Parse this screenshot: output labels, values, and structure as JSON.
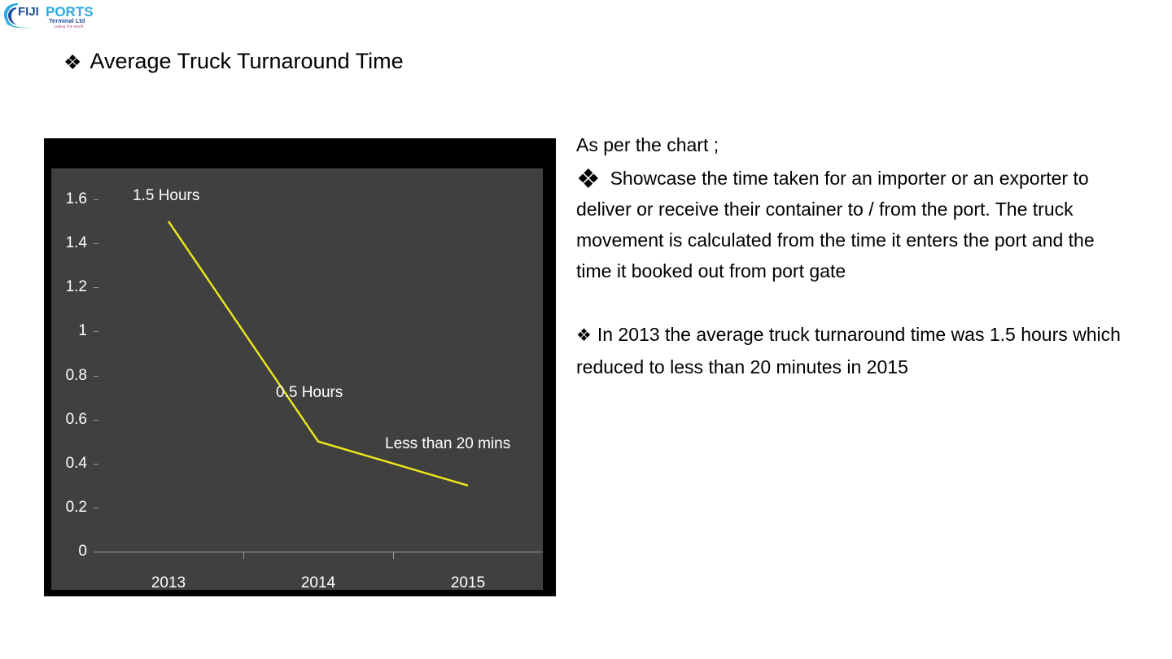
{
  "logo": {
    "brand_primary": "FIJI",
    "brand_secondary": "PORTS",
    "sub_line": "Terminal Ltd",
    "tagline": "Linking The World",
    "color_blue": "#1f4e9c",
    "color_cyan": "#29aae1",
    "color_teal": "#2bb3c0"
  },
  "slide": {
    "bullet_glyph": "❖",
    "title": "Average Truck Turnaround Time"
  },
  "chart_data": {
    "type": "line",
    "title": "",
    "xlabel": "",
    "ylabel": "",
    "categories": [
      "2013",
      "2014",
      "2015"
    ],
    "values": [
      1.5,
      0.5,
      0.3
    ],
    "series": [
      {
        "name": "Average Truck Turnaround Time",
        "values": [
          1.5,
          0.5,
          0.3
        ],
        "color": "#ece81a"
      }
    ],
    "ylim": [
      0,
      1.6
    ],
    "ytick_labels": [
      "1.6",
      "1.4",
      "1.2",
      "1",
      "0.8",
      "0.6",
      "0.4",
      "0.2",
      "0"
    ],
    "ytick_values": [
      1.6,
      1.4,
      1.2,
      1.0,
      0.8,
      0.6,
      0.4,
      0.2,
      0
    ],
    "grid": false,
    "legend": "none",
    "point_labels": [
      "1.5 Hours",
      "0.5 Hours",
      "Less than 20 mins"
    ],
    "plot_background": "#404040",
    "frame_background": "#000000",
    "axis_color": "#9a9a9a",
    "text_color": "#ffffff"
  },
  "text_panel": {
    "heading": "As per the chart ;",
    "bullet_glyph_large": "❖",
    "bullet_glyph_small": "❖",
    "item1_first_line": "Showcase the time taken for an importer",
    "item1_rest": "or an exporter to deliver or receive their container to / from the port. The truck movement is calculated from the time it enters the port and the time it booked out from port gate",
    "item2": "In 2013 the average truck turnaround time was 1.5 hours which reduced to less than 20 minutes in 2015"
  }
}
